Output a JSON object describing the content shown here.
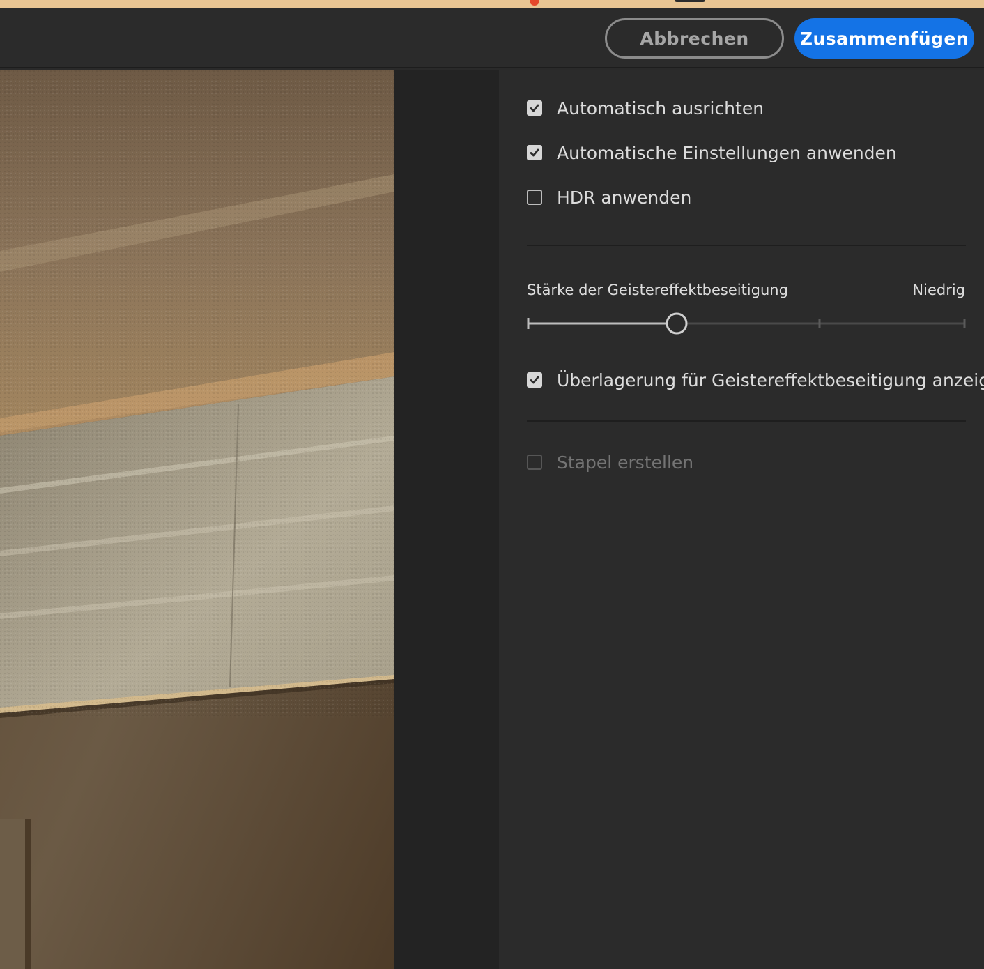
{
  "toolbar": {
    "cancel_label": "Abbrechen",
    "merge_label": "Zusammenfügen"
  },
  "options": {
    "auto_align": {
      "label": "Automatisch ausrichten",
      "checked": true
    },
    "auto_settings": {
      "label": "Automatische Einstellungen anwenden",
      "checked": true
    },
    "apply_hdr": {
      "label": "HDR anwenden",
      "checked": false
    },
    "show_overlay": {
      "label": "Überlagerung für Geistereffektbeseitigung anzeigen",
      "checked": true
    },
    "create_stack": {
      "label": "Stapel erstellen",
      "checked": false,
      "disabled": true
    }
  },
  "deghost": {
    "label": "Stärke der Geistereffektbeseitigung",
    "value_label": "Niedrig",
    "level": 1,
    "levels": 4
  },
  "colors": {
    "accent": "#1473e6",
    "panel_bg": "#2b2b2b",
    "top_strip": "#e9c593"
  }
}
